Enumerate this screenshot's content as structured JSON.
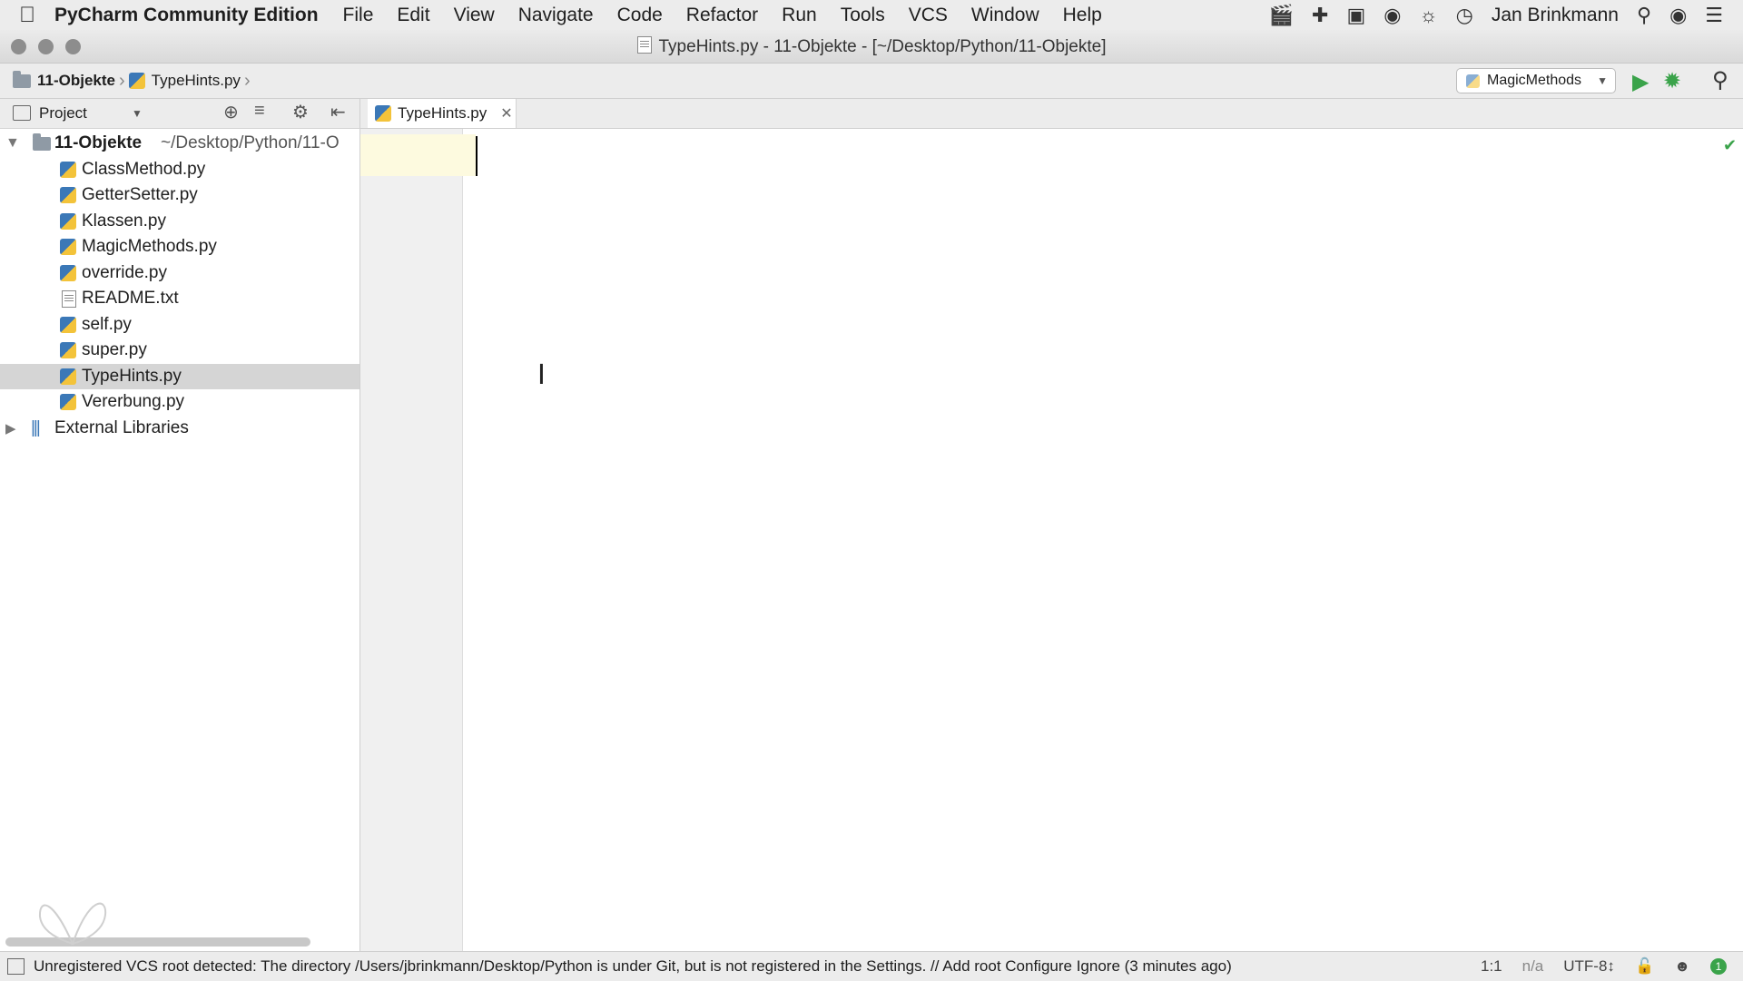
{
  "menubar": {
    "app_name": "PyCharm Community Edition",
    "items": [
      "File",
      "Edit",
      "View",
      "Navigate",
      "Code",
      "Refactor",
      "Run",
      "Tools",
      "VCS",
      "Window",
      "Help"
    ],
    "user_name": "Jan Brinkmann"
  },
  "window": {
    "title": "TypeHints.py - 11-Objekte - [~/Desktop/Python/11-Objekte]"
  },
  "navbar": {
    "crumbs": [
      "11-Objekte",
      "TypeHints.py"
    ],
    "run_config": "MagicMethods"
  },
  "project": {
    "view_label": "Project",
    "root_name": "11-Objekte",
    "root_path": "~/Desktop/Python/11-O",
    "files": [
      {
        "name": "ClassMethod.py",
        "icon": "python-file-icon"
      },
      {
        "name": "GetterSetter.py",
        "icon": "python-file-icon"
      },
      {
        "name": "Klassen.py",
        "icon": "python-file-icon"
      },
      {
        "name": "MagicMethods.py",
        "icon": "python-file-icon"
      },
      {
        "name": "override.py",
        "icon": "python-file-icon"
      },
      {
        "name": "README.txt",
        "icon": "text-file-icon"
      },
      {
        "name": "self.py",
        "icon": "python-file-icon"
      },
      {
        "name": "super.py",
        "icon": "python-file-icon"
      },
      {
        "name": "TypeHints.py",
        "icon": "python-file-icon",
        "selected": true
      },
      {
        "name": "Vererbung.py",
        "icon": "python-file-icon"
      }
    ],
    "external_libraries": "External Libraries"
  },
  "editor": {
    "tab_label": "TypeHints.py"
  },
  "status": {
    "message": "Unregistered VCS root detected: The directory /Users/jbrinkmann/Desktop/Python is under Git, but is not registered in the Settings. // Add root  Configure  Ignore (3 minutes ago)",
    "position": "1:1",
    "line_separator": "n/a",
    "encoding": "UTF-8↕"
  },
  "colors": {
    "run_green": "#3aa34a",
    "selection": "#d5d5d5",
    "current_line": "#fdfadf"
  }
}
